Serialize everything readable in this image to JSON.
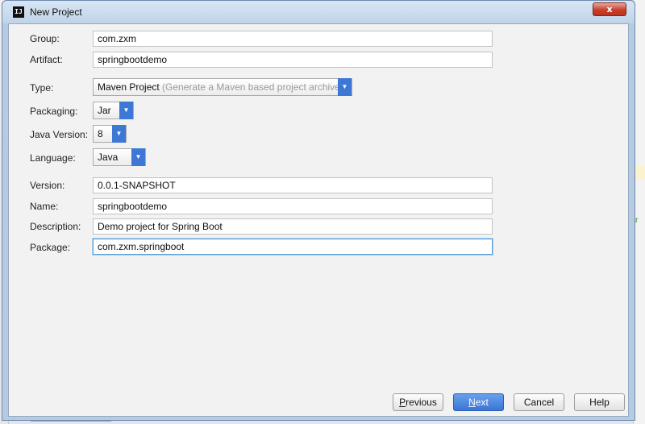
{
  "window": {
    "title": "New Project",
    "close_label": "x",
    "app_icon_label": "IJ"
  },
  "form": {
    "group": {
      "label": "Group:",
      "value": "com.zxm"
    },
    "artifact": {
      "label": "Artifact:",
      "value": "springbootdemo"
    },
    "type": {
      "label": "Type:",
      "value": "Maven Project",
      "hint": "(Generate a Maven based project archive)"
    },
    "packaging": {
      "label": "Packaging:",
      "value": "Jar"
    },
    "java_version": {
      "label": "Java Version:",
      "value": "8"
    },
    "language": {
      "label": "Language:",
      "value": "Java"
    },
    "version": {
      "label": "Version:",
      "value": "0.0.1-SNAPSHOT"
    },
    "name": {
      "label": "Name:",
      "value": "springbootdemo"
    },
    "description": {
      "label": "Description:",
      "value": "Demo project for Spring Boot"
    },
    "package": {
      "label": "Package:",
      "value": "com.zxm.springboot"
    }
  },
  "buttons": {
    "previous_mnemonic": "P",
    "previous_rest": "revious",
    "next_mnemonic": "N",
    "next_rest": "ext",
    "cancel": "Cancel",
    "help": "Help"
  },
  "colors": {
    "accent": "#3e78d6",
    "focus_border": "#5a9fd6",
    "close_red": "#c9412c"
  },
  "icons": {
    "dropdown_arrow": "chevron-down-icon",
    "close": "close-icon",
    "app": "intellij-icon"
  }
}
